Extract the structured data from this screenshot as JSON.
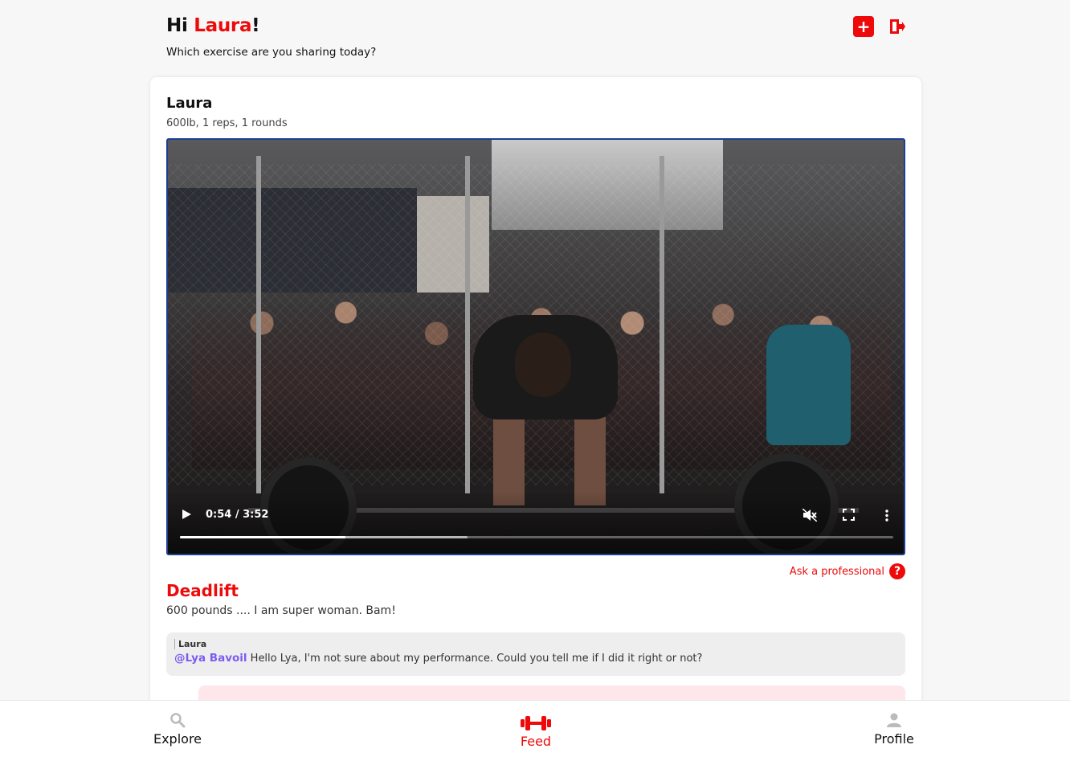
{
  "header": {
    "greeting_prefix": "Hi ",
    "user_name": "Laura",
    "greeting_suffix": "!",
    "subtitle": "Which exercise are you sharing today?",
    "add_icon": "plus-icon",
    "logout_icon": "logout-icon"
  },
  "post": {
    "author": "Laura",
    "stats": "600lb, 1 reps, 1 rounds",
    "video": {
      "current_time": "0:54",
      "duration": "3:52",
      "time_display": "0:54 / 3:52",
      "progress_fraction": 0.232,
      "buffered_fraction": 0.403,
      "muted": true
    },
    "ask_professional": "Ask a professional",
    "exercise_title": "Deadlift",
    "description": "600 pounds .... I am super woman. Bam!",
    "comments": [
      {
        "author": "Laura",
        "mention": "@Lya Bavoil",
        "text": " Hello Lya, I'm not sure about my performance. Could you tell me if I did it right or not?"
      }
    ]
  },
  "nav": {
    "explore": "Explore",
    "feed": "Feed",
    "profile": "Profile",
    "active": "feed"
  },
  "colors": {
    "accent": "#ee0a0a",
    "mention": "#7c5cf0",
    "video_border": "#1d3f8f"
  }
}
